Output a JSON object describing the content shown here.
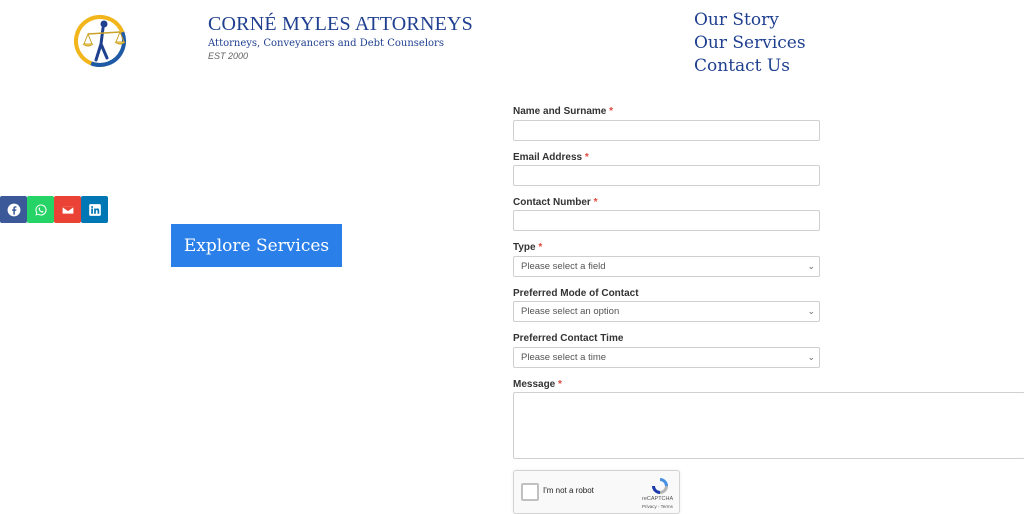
{
  "header": {
    "title": "CORNÉ MYLES ATTORNEYS",
    "subtitle": "Attorneys, Conveyancers and Debt Counselors",
    "est": "EST 2000",
    "logo_icon": "scales-of-justice-logo"
  },
  "nav": {
    "items": [
      "Our Story",
      "Our Services",
      "Contact Us"
    ]
  },
  "share": {
    "items": [
      {
        "icon": "facebook-icon",
        "color": "#3b5998"
      },
      {
        "icon": "whatsapp-icon",
        "color": "#25d366"
      },
      {
        "icon": "email-icon",
        "color": "#ea4335"
      },
      {
        "icon": "linkedin-icon",
        "color": "#0077b5"
      }
    ]
  },
  "cta": {
    "label": "Explore Services"
  },
  "form": {
    "required_mark": "*",
    "name_label": "Name and Surname",
    "email_label": "Email Address",
    "contact_label": "Contact Number",
    "type_label": "Type",
    "type_value": "Please select a field",
    "mode_label": "Preferred Mode of Contact",
    "mode_value": "Please select an option",
    "time_label": "Preferred Contact Time",
    "time_value": "Please select a time",
    "message_label": "Message"
  },
  "captcha": {
    "label": "I'm not a robot",
    "brand": "reCAPTCHA",
    "terms": "Privacy - Terms"
  },
  "colors": {
    "brand_blue": "#1f3f8f",
    "cta_blue": "#2a7fe8",
    "required_red": "#e0463d"
  }
}
